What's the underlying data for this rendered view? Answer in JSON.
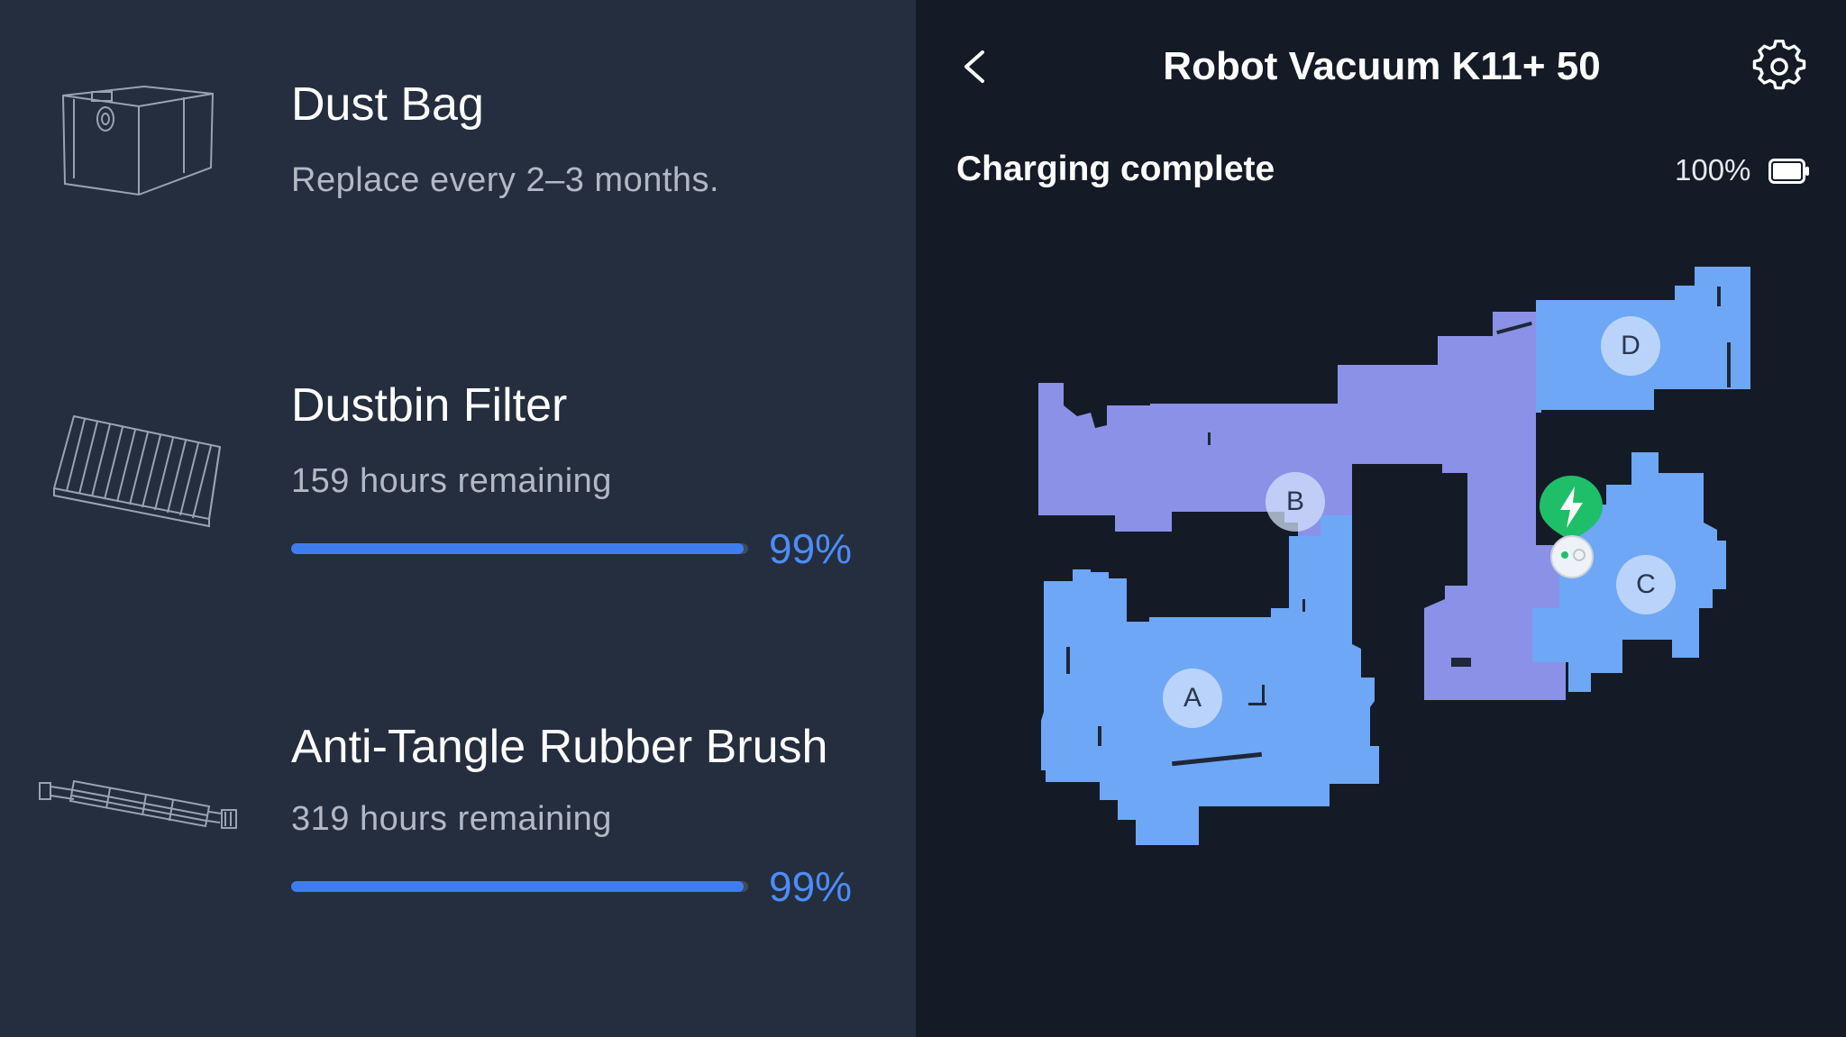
{
  "app": {
    "title": "Robot Vacuum K11+ 50"
  },
  "status": {
    "text": "Charging complete",
    "battery_text": "100%",
    "battery_level": 1.0
  },
  "parts": [
    {
      "name": "Dust Bag",
      "subtitle": "Replace every 2–3 months.",
      "icon": "dust-bag-icon"
    },
    {
      "name": "Dustbin Filter",
      "subtitle": "159 hours remaining",
      "percent_text": "99%",
      "progress": 0.99,
      "icon": "filter-icon"
    },
    {
      "name": "Anti-Tangle Rubber Brush",
      "subtitle": "319 hours remaining",
      "percent_text": "99%",
      "progress": 0.99,
      "icon": "brush-icon"
    }
  ],
  "map": {
    "rooms": [
      {
        "label": "A",
        "color": "#6ea7f5"
      },
      {
        "label": "B",
        "color": "#8a91e6"
      },
      {
        "label": "C",
        "color": "#6ea7f5"
      },
      {
        "label": "D",
        "color": "#6ea7f5"
      }
    ],
    "dock_icon": "lightning-icon",
    "robot_icon": "robot-vacuum-icon"
  },
  "colors": {
    "left_bg": "#252e3e",
    "right_bg": "#141b26",
    "accent": "#3f7cf0",
    "dock": "#1fbf6a"
  }
}
